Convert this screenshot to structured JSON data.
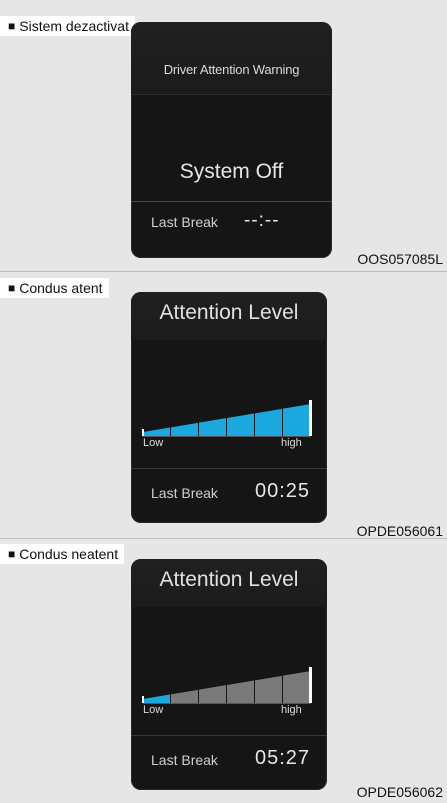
{
  "panels": [
    {
      "caption": "Sistem dezactivat",
      "code": "OOS057085L",
      "title": "Driver Attention Warning",
      "status": "System Off",
      "last_break_label": "Last Break",
      "last_break_value": "--:--"
    },
    {
      "caption": "Condus atent",
      "code": "OPDE056061",
      "title": "Attention Level",
      "low_label": "Low",
      "high_label": "high",
      "level": 1.0,
      "last_break_label": "Last Break",
      "last_break_value": "00:25"
    },
    {
      "caption": "Condus neatent",
      "code": "OPDE056062",
      "title": "Attention Level",
      "low_label": "Low",
      "high_label": "high",
      "level": 0.2,
      "last_break_label": "Last Break",
      "last_break_value": "05:27"
    }
  ],
  "colors": {
    "level_fill": "#1aa8df",
    "level_empty": "#7a7a7a"
  }
}
